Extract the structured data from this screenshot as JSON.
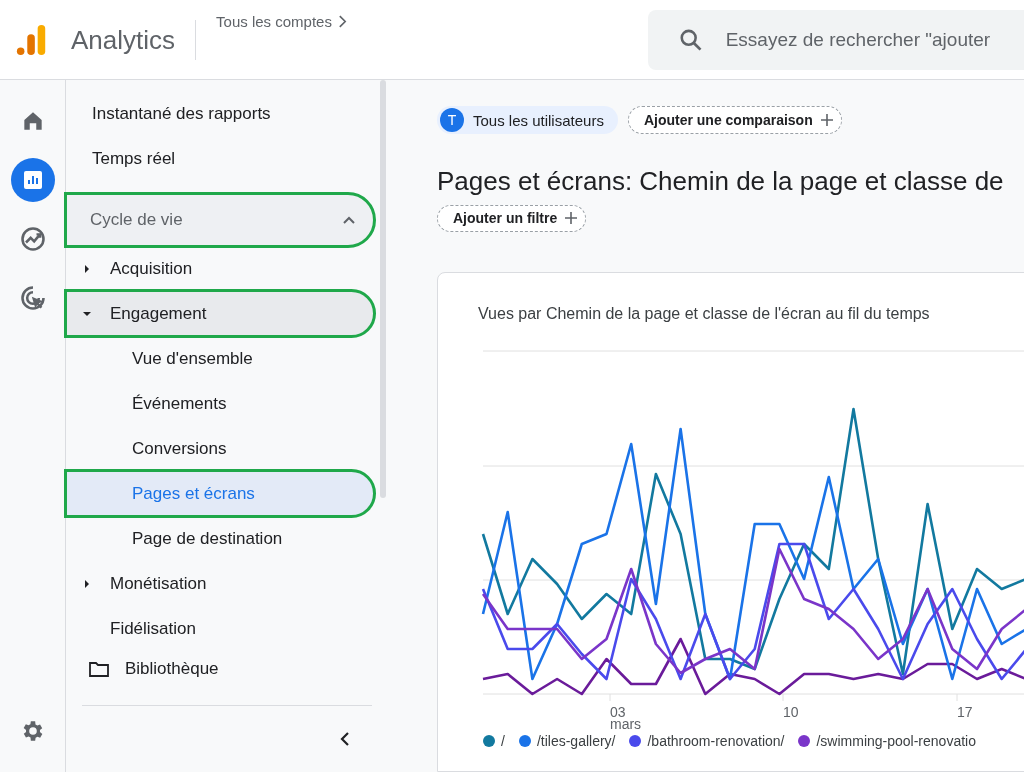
{
  "header": {
    "product": "Analytics",
    "breadcrumb": "Tous les comptes",
    "search": {
      "placeholder": "Essayez de rechercher \"ajouter"
    }
  },
  "rail": [
    {
      "kind": "home",
      "selected": false
    },
    {
      "kind": "reports",
      "selected": true
    },
    {
      "kind": "explore",
      "selected": false
    },
    {
      "kind": "advertising",
      "selected": false
    }
  ],
  "sidebar": {
    "items": [
      {
        "label": "Instantané des rapports"
      },
      {
        "label": "Temps réel"
      }
    ],
    "section": {
      "label": "Cycle de vie",
      "expanded": true,
      "highlighted": true,
      "children": [
        {
          "label": "Acquisition",
          "kind": "group",
          "expanded": false,
          "highlighted": false
        },
        {
          "label": "Engagement",
          "kind": "group",
          "expanded": true,
          "highlighted": true,
          "children": [
            {
              "label": "Vue d'ensemble",
              "selected": false,
              "highlighted": false
            },
            {
              "label": "Événements",
              "selected": false,
              "highlighted": false
            },
            {
              "label": "Conversions",
              "selected": false,
              "highlighted": false
            },
            {
              "label": "Pages et écrans",
              "selected": true,
              "highlighted": true
            },
            {
              "label": "Page de destination",
              "selected": false,
              "highlighted": false
            }
          ]
        },
        {
          "label": "Monétisation",
          "kind": "group",
          "expanded": false,
          "highlighted": false
        },
        {
          "label": "Fidélisation",
          "kind": "link",
          "expanded": false,
          "highlighted": false
        }
      ]
    },
    "library": "Bibliothèque"
  },
  "filters": {
    "audience": {
      "badge": "T",
      "label": "Tous les utilisateurs"
    },
    "compare": "Ajouter une comparaison"
  },
  "page_title": "Pages et écrans: Chemin de la page et classe de",
  "add_filter": "Ajouter un filtre",
  "chart": {
    "title": "Vues par Chemin de la page et classe de l'écran au fil du temps",
    "x_labels": [
      {
        "day": "03",
        "month": "mars"
      },
      {
        "day": "10"
      },
      {
        "day": "17"
      }
    ],
    "legend": [
      {
        "label": "/",
        "color": "#12799f"
      },
      {
        "label": "/tiles-gallery/",
        "color": "#1a73e8"
      },
      {
        "label": "/bathroom-renovation/",
        "color": "#4a4aec"
      },
      {
        "label": "/swimming-pool-renovatio",
        "color": "#7a35c9"
      }
    ]
  }
}
